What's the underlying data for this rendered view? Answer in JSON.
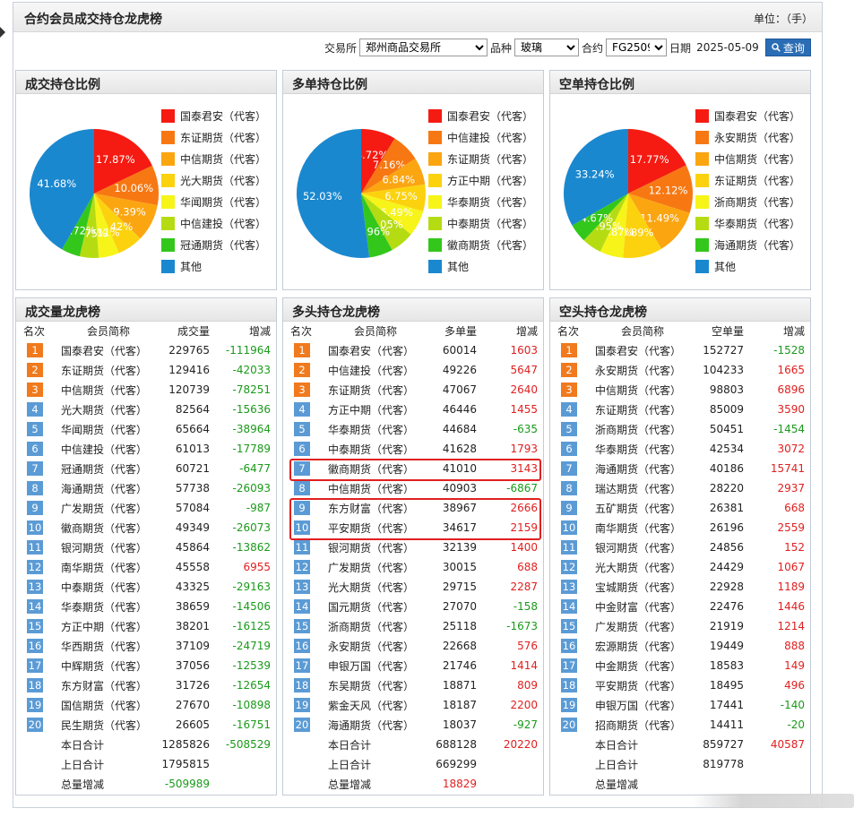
{
  "header": {
    "title": "合约会员成交持仓龙虎榜",
    "unit": "单位：（手）"
  },
  "filters": {
    "exchange_label": "交易所",
    "exchange_value": "郑州商品交易所",
    "product_label": "品种",
    "product_value": "玻璃",
    "contract_label": "合约",
    "contract_value": "FG2509",
    "date_label": "日期",
    "date_value": "2025-05-09",
    "query_label": "查询"
  },
  "colors": [
    "#f51b12",
    "#f77812",
    "#fba511",
    "#fcd20f",
    "#f6f419",
    "#b5dc13",
    "#33c71b",
    "#1a88cf"
  ],
  "pies": [
    {
      "title": "成交持仓比例",
      "legend": [
        "国泰君安（代客）",
        "东证期货（代客）",
        "中信期货（代客）",
        "光大期货（代客）",
        "华闻期货（代客）",
        "中信建投（代客）",
        "冠通期货（代客）",
        "其他"
      ],
      "values": [
        17.87,
        10.06,
        9.39,
        6.42,
        5.11,
        4.75,
        4.72,
        41.68
      ],
      "labels": [
        "17.87%",
        "10.06%",
        "9.39%",
        "6.42%",
        "5.11%",
        "4.75%",
        "4.72%",
        "41.68%"
      ]
    },
    {
      "title": "多单持仓比例",
      "legend": [
        "国泰君安（代客）",
        "中信建投（代客）",
        "东证期货（代客）",
        "方正中期（代客）",
        "华泰期货（代客）",
        "中泰期货（代客）",
        "徽商期货（代客）",
        "其他"
      ],
      "values": [
        8.72,
        7.16,
        6.84,
        6.75,
        6.49,
        6.05,
        5.96,
        52.03
      ],
      "labels": [
        "8.72%",
        "7.16%",
        "6.84%",
        "6.75%",
        "6.49%",
        "6.05%",
        "5.96%",
        "52.03%"
      ]
    },
    {
      "title": "空单持仓比例",
      "legend": [
        "国泰君安（代客）",
        "永安期货（代客）",
        "中信期货（代客）",
        "东证期货（代客）",
        "浙商期货（代客）",
        "华泰期货（代客）",
        "海通期货（代客）",
        "其他"
      ],
      "values": [
        17.77,
        12.12,
        11.49,
        9.89,
        5.87,
        4.95,
        4.67,
        33.24
      ],
      "labels": [
        "17.77%",
        "12.12%",
        "11.49%",
        "9.89%",
        "5.87%",
        "4.95%",
        "4.67%",
        "33.24%"
      ]
    }
  ],
  "tables": [
    {
      "title": "成交量龙虎榜",
      "headers": [
        "名次",
        "会员简称",
        "成交量",
        "增减"
      ],
      "rows": [
        [
          "1",
          "国泰君安（代客）",
          "229765",
          "-111964"
        ],
        [
          "2",
          "东证期货（代客）",
          "129416",
          "-42033"
        ],
        [
          "3",
          "中信期货（代客）",
          "120739",
          "-78251"
        ],
        [
          "4",
          "光大期货（代客）",
          "82564",
          "-15636"
        ],
        [
          "5",
          "华闻期货（代客）",
          "65664",
          "-38964"
        ],
        [
          "6",
          "中信建投（代客）",
          "61013",
          "-17789"
        ],
        [
          "7",
          "冠通期货（代客）",
          "60721",
          "-6477"
        ],
        [
          "8",
          "海通期货（代客）",
          "57738",
          "-26093"
        ],
        [
          "9",
          "广发期货（代客）",
          "57084",
          "-987"
        ],
        [
          "10",
          "徽商期货（代客）",
          "49349",
          "-26073"
        ],
        [
          "11",
          "银河期货（代客）",
          "45864",
          "-13862"
        ],
        [
          "12",
          "南华期货（代客）",
          "45558",
          "6955"
        ],
        [
          "13",
          "中泰期货（代客）",
          "43325",
          "-29163"
        ],
        [
          "14",
          "华泰期货（代客）",
          "38659",
          "-14506"
        ],
        [
          "15",
          "方正中期（代客）",
          "38201",
          "-16125"
        ],
        [
          "16",
          "华西期货（代客）",
          "37109",
          "-24719"
        ],
        [
          "17",
          "中辉期货（代客）",
          "37056",
          "-12539"
        ],
        [
          "18",
          "东方财富（代客）",
          "31726",
          "-12654"
        ],
        [
          "19",
          "国信期货（代客）",
          "27670",
          "-10898"
        ],
        [
          "20",
          "民生期货（代客）",
          "26605",
          "-16751"
        ]
      ],
      "totals": [
        [
          "本日合计",
          "1285826",
          "-508529"
        ],
        [
          "上日合计",
          "1795815",
          ""
        ],
        [
          "总量增减",
          "-509989",
          ""
        ]
      ]
    },
    {
      "title": "多头持仓龙虎榜",
      "headers": [
        "名次",
        "会员简称",
        "多单量",
        "增减"
      ],
      "rows": [
        [
          "1",
          "国泰君安（代客）",
          "60014",
          "1603"
        ],
        [
          "2",
          "中信建投（代客）",
          "49226",
          "5647"
        ],
        [
          "3",
          "东证期货（代客）",
          "47067",
          "2640"
        ],
        [
          "4",
          "方正中期（代客）",
          "46446",
          "1455"
        ],
        [
          "5",
          "华泰期货（代客）",
          "44684",
          "-635"
        ],
        [
          "6",
          "中泰期货（代客）",
          "41628",
          "1793"
        ],
        [
          "7",
          "徽商期货（代客）",
          "41010",
          "3143"
        ],
        [
          "8",
          "中信期货（代客）",
          "40903",
          "-6867"
        ],
        [
          "9",
          "东方财富（代客）",
          "38967",
          "2666"
        ],
        [
          "10",
          "平安期货（代客）",
          "34617",
          "2159"
        ],
        [
          "11",
          "银河期货（代客）",
          "32139",
          "1400"
        ],
        [
          "12",
          "广发期货（代客）",
          "30015",
          "688"
        ],
        [
          "13",
          "光大期货（代客）",
          "29715",
          "2287"
        ],
        [
          "14",
          "国元期货（代客）",
          "27070",
          "-158"
        ],
        [
          "15",
          "浙商期货（代客）",
          "25118",
          "-1673"
        ],
        [
          "16",
          "永安期货（代客）",
          "22668",
          "576"
        ],
        [
          "17",
          "申银万国（代客）",
          "21746",
          "1414"
        ],
        [
          "18",
          "东吴期货（代客）",
          "18871",
          "809"
        ],
        [
          "19",
          "紫金天风（代客）",
          "18187",
          "2200"
        ],
        [
          "20",
          "海通期货（代客）",
          "18037",
          "-927"
        ]
      ],
      "totals": [
        [
          "本日合计",
          "688128",
          "20220"
        ],
        [
          "上日合计",
          "669299",
          ""
        ],
        [
          "总量增减",
          "18829",
          ""
        ]
      ]
    },
    {
      "title": "空头持仓龙虎榜",
      "headers": [
        "名次",
        "会员简称",
        "空单量",
        "增减"
      ],
      "rows": [
        [
          "1",
          "国泰君安（代客）",
          "152727",
          "-1528"
        ],
        [
          "2",
          "永安期货（代客）",
          "104233",
          "1665"
        ],
        [
          "3",
          "中信期货（代客）",
          "98803",
          "6896"
        ],
        [
          "4",
          "东证期货（代客）",
          "85009",
          "3590"
        ],
        [
          "5",
          "浙商期货（代客）",
          "50451",
          "-1454"
        ],
        [
          "6",
          "华泰期货（代客）",
          "42534",
          "3072"
        ],
        [
          "7",
          "海通期货（代客）",
          "40186",
          "15741"
        ],
        [
          "8",
          "瑞达期货（代客）",
          "28220",
          "2937"
        ],
        [
          "9",
          "五矿期货（代客）",
          "26381",
          "668"
        ],
        [
          "10",
          "南华期货（代客）",
          "26196",
          "2559"
        ],
        [
          "11",
          "银河期货（代客）",
          "24856",
          "152"
        ],
        [
          "12",
          "光大期货（代客）",
          "24429",
          "1067"
        ],
        [
          "13",
          "宝城期货（代客）",
          "22928",
          "1189"
        ],
        [
          "14",
          "中金财富（代客）",
          "22476",
          "1446"
        ],
        [
          "15",
          "广发期货（代客）",
          "21919",
          "1214"
        ],
        [
          "16",
          "宏源期货（代客）",
          "19449",
          "888"
        ],
        [
          "17",
          "中金期货（代客）",
          "18583",
          "149"
        ],
        [
          "18",
          "平安期货（代客）",
          "18495",
          "496"
        ],
        [
          "19",
          "申银万国（代客）",
          "17441",
          "-140"
        ],
        [
          "20",
          "招商期货（代客）",
          "14411",
          "-20"
        ]
      ],
      "totals": [
        [
          "本日合计",
          "859727",
          "40587"
        ],
        [
          "上日合计",
          "819778",
          ""
        ],
        [
          "总量增减",
          "",
          ""
        ]
      ]
    }
  ]
}
